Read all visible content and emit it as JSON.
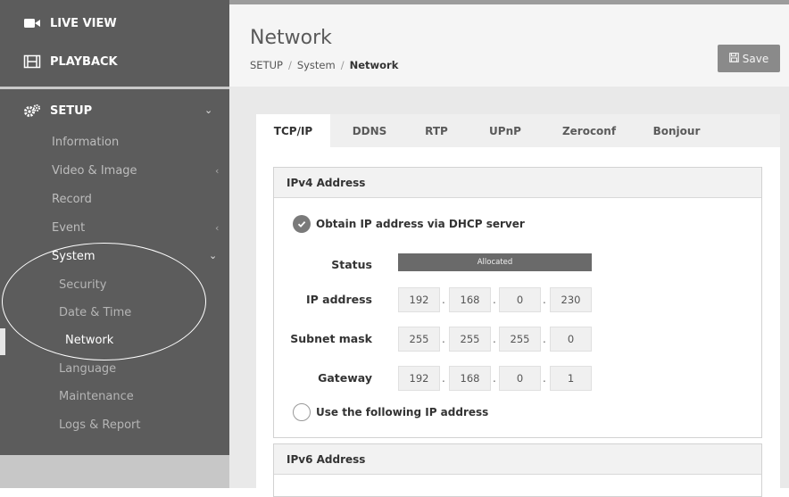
{
  "sidebar": {
    "live_view": "LIVE VIEW",
    "playback": "PLAYBACK",
    "setup": "SETUP",
    "items": {
      "information": "Information",
      "video_image": "Video & Image",
      "record": "Record",
      "event": "Event",
      "system": "System",
      "security": "Security",
      "date_time": "Date & Time",
      "network": "Network",
      "language": "Language",
      "maintenance": "Maintenance",
      "logs_report": "Logs & Report"
    }
  },
  "header": {
    "title": "Network",
    "breadcrumb": [
      "SETUP",
      "System",
      "Network"
    ],
    "save_label": "Save"
  },
  "tabs": [
    "TCP/IP",
    "DDNS",
    "RTP",
    "UPnP",
    "Zeroconf",
    "Bonjour"
  ],
  "active_tab": "TCP/IP",
  "ipv4": {
    "title": "IPv4 Address",
    "dhcp_option": "Obtain IP address via DHCP server",
    "dhcp_selected": true,
    "status_label": "Status",
    "status_value": "Allocated",
    "ip_label": "IP address",
    "ip": [
      "192",
      "168",
      "0",
      "230"
    ],
    "subnet_label": "Subnet mask",
    "subnet": [
      "255",
      "255",
      "255",
      "0"
    ],
    "gateway_label": "Gateway",
    "gateway": [
      "192",
      "168",
      "0",
      "1"
    ],
    "static_option": "Use the following IP address"
  },
  "ipv6": {
    "title": "IPv6 Address"
  },
  "colors": {
    "sidebar_dark": "#5c5c5c",
    "sidebar_light": "#c9c9c9",
    "accent_button": "#8a8a8a",
    "status_bar": "#6a6a6a"
  },
  "icons": {
    "live_view": "video-camera-icon",
    "playback": "film-icon",
    "setup": "gears-icon",
    "save": "floppy-disk-icon",
    "dhcp_radio": "check-circle-icon"
  }
}
